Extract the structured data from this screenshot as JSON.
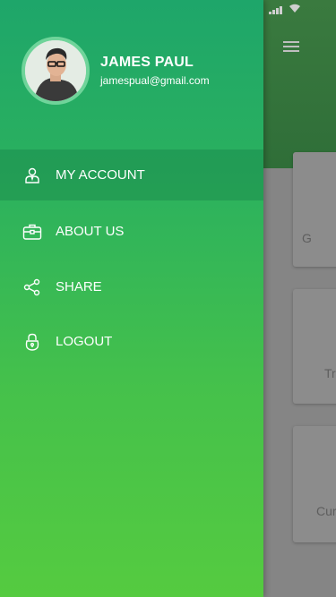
{
  "profile": {
    "name": "JAMES PAUL",
    "email": "jamespual@gmail.com"
  },
  "menu": {
    "items": [
      {
        "label": "MY ACCOUNT",
        "icon": "user-icon",
        "active": true
      },
      {
        "label": "ABOUT US",
        "icon": "briefcase-icon",
        "active": false
      },
      {
        "label": "SHARE",
        "icon": "share-icon",
        "active": false
      },
      {
        "label": "LOGOUT",
        "icon": "lock-icon",
        "active": false
      }
    ]
  },
  "background": {
    "cards": [
      {
        "label": "G"
      },
      {
        "label": "Tr"
      },
      {
        "label": "Cur"
      }
    ]
  },
  "colors": {
    "drawer_top": "#1ea66a",
    "drawer_bottom": "#55cb40",
    "header": "#2f6e38",
    "text": "#ffffff"
  }
}
